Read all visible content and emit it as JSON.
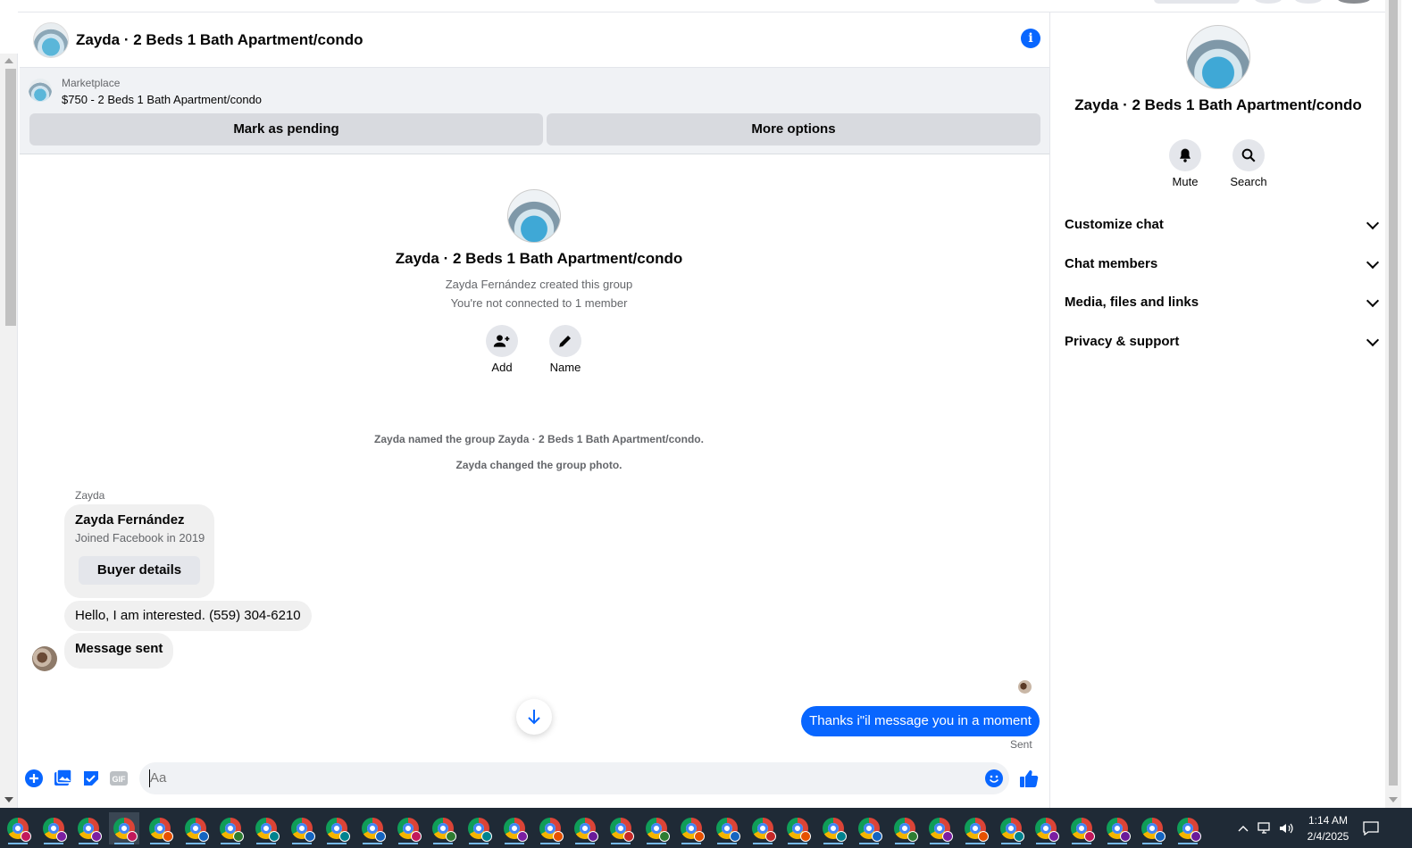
{
  "header": {
    "title": "Zayda · 2 Beds 1 Bath Apartment/condo"
  },
  "marketplace": {
    "label": "Marketplace",
    "listing": "$750 - 2 Beds 1 Bath Apartment/condo",
    "pending_button": "Mark as pending",
    "more_button": "More options"
  },
  "group": {
    "title": "Zayda · 2 Beds 1 Bath Apartment/condo",
    "created_by": "Zayda Fernández created this group",
    "connection": "You're not connected to 1 member",
    "add_label": "Add",
    "name_label": "Name"
  },
  "system_messages": [
    "Zayda named the group Zayda · 2 Beds 1 Bath Apartment/condo.",
    "Zayda changed the group photo."
  ],
  "conversation": {
    "sender_name": "Zayda",
    "card": {
      "name": "Zayda Fernández",
      "joined": "Joined Facebook in 2019",
      "button": "Buyer details"
    },
    "incoming": [
      "Hello, I am interested. (559) 304-6210",
      "Message sent"
    ],
    "outgoing": "Thanks i\"il message you in a moment",
    "status": "Sent"
  },
  "composer": {
    "placeholder": "Aa"
  },
  "right_panel": {
    "title": "Zayda · 2 Beds 1 Bath Apartment/condo",
    "mute_label": "Mute",
    "search_label": "Search",
    "sections": [
      "Customize chat",
      "Chat members",
      "Media, files and links",
      "Privacy & support"
    ]
  },
  "taskbar": {
    "time": "1:14 AM",
    "date": "2/4/2025",
    "badge_colors": [
      "#c2185b",
      "#7b1fa2",
      "#7b1fa2",
      "#c2185b",
      "#e65100",
      "#1565c0",
      "#2e7d32",
      "#00838f",
      "#1565c0",
      "#00838f",
      "#1565c0",
      "#c2185b",
      "#2e7d32",
      "#00838f",
      "#7b1fa2",
      "#e65100",
      "#6a1b9a",
      "#c62828",
      "#2e7d32",
      "#e65100",
      "#1565c0",
      "#c62828",
      "#e65100",
      "#00838f",
      "#1565c0",
      "#2e7d32",
      "#7b1fa2",
      "#e65100",
      "#00838f",
      "#7b1fa2",
      "#c2185b",
      "#6a1b9a",
      "#1565c0",
      "#6a1b9a"
    ]
  },
  "colors": {
    "accent": "#0866ff",
    "bubble_in": "#f0f0f0",
    "taskbar": "#1f2a36"
  }
}
